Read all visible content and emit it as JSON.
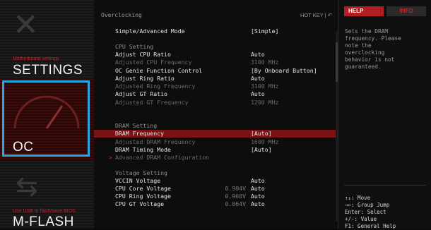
{
  "nav": {
    "settings": {
      "sub": "Motherboard settings",
      "title": "SETTINGS"
    },
    "oc": {
      "title": "OC"
    },
    "mflash": {
      "sub": "Use USB to flash/save BIOS",
      "title": "M-FLASH"
    }
  },
  "main": {
    "header": "Overclocking",
    "hotkey": "HOT KEY  |  ↶",
    "rows": [
      {
        "label": "Simple/Advanced Mode",
        "value": "[Simple]",
        "style": "normal"
      },
      {
        "label": "CPU Setting",
        "style": "sec"
      },
      {
        "label": "Adjust CPU Ratio",
        "value": "Auto",
        "style": "normal"
      },
      {
        "label": "Adjusted CPU Frequency",
        "value": "3100 MHz",
        "style": "dim"
      },
      {
        "label": "OC Genie Function Control",
        "value": "[By Onboard Button]",
        "style": "normal"
      },
      {
        "label": "Adjust Ring Ratio",
        "value": "Auto",
        "style": "normal"
      },
      {
        "label": "Adjusted Ring Frequency",
        "value": "3100 MHz",
        "style": "dim"
      },
      {
        "label": "Adjust GT Ratio",
        "value": "Auto",
        "style": "normal"
      },
      {
        "label": "Adjusted GT Frequency",
        "value": "1200 MHz",
        "style": "dim"
      },
      {
        "label": "DRAM Setting",
        "style": "sec"
      },
      {
        "label": "DRAM Frequency",
        "value": "[Auto]",
        "style": "sel"
      },
      {
        "label": "Adjusted DRAM Frequency",
        "value": "1600 MHz",
        "style": "dim"
      },
      {
        "label": "DRAM Timing Mode",
        "value": "[Auto]",
        "style": "normal"
      },
      {
        "label": "Advanced DRAM Configuration",
        "style": "dim",
        "arrow": ">"
      },
      {
        "label": "Voltage Setting",
        "style": "sec"
      },
      {
        "label": "VCCIN Voltage",
        "value": "Auto",
        "style": "normal"
      },
      {
        "label": "CPU Core Voltage",
        "mid": "0.904V",
        "value": "Auto",
        "style": "normal"
      },
      {
        "label": "CPU Ring Voltage",
        "mid": "0.960V",
        "value": "Auto",
        "style": "normal"
      },
      {
        "label": "CPU GT Voltage",
        "mid": "0.064V",
        "value": "Auto",
        "style": "normal"
      }
    ]
  },
  "help": {
    "tab_help": "HELP",
    "tab_info": "INFO",
    "lines": [
      "Sets the DRAM",
      "frequency. Please",
      "note the",
      "overclocking",
      "behavior is not",
      "guaranteed."
    ],
    "keys": [
      "↑↓: Move",
      "→←: Group Jump",
      "Enter: Select",
      "+/-: Value",
      "F1: General Help"
    ]
  }
}
